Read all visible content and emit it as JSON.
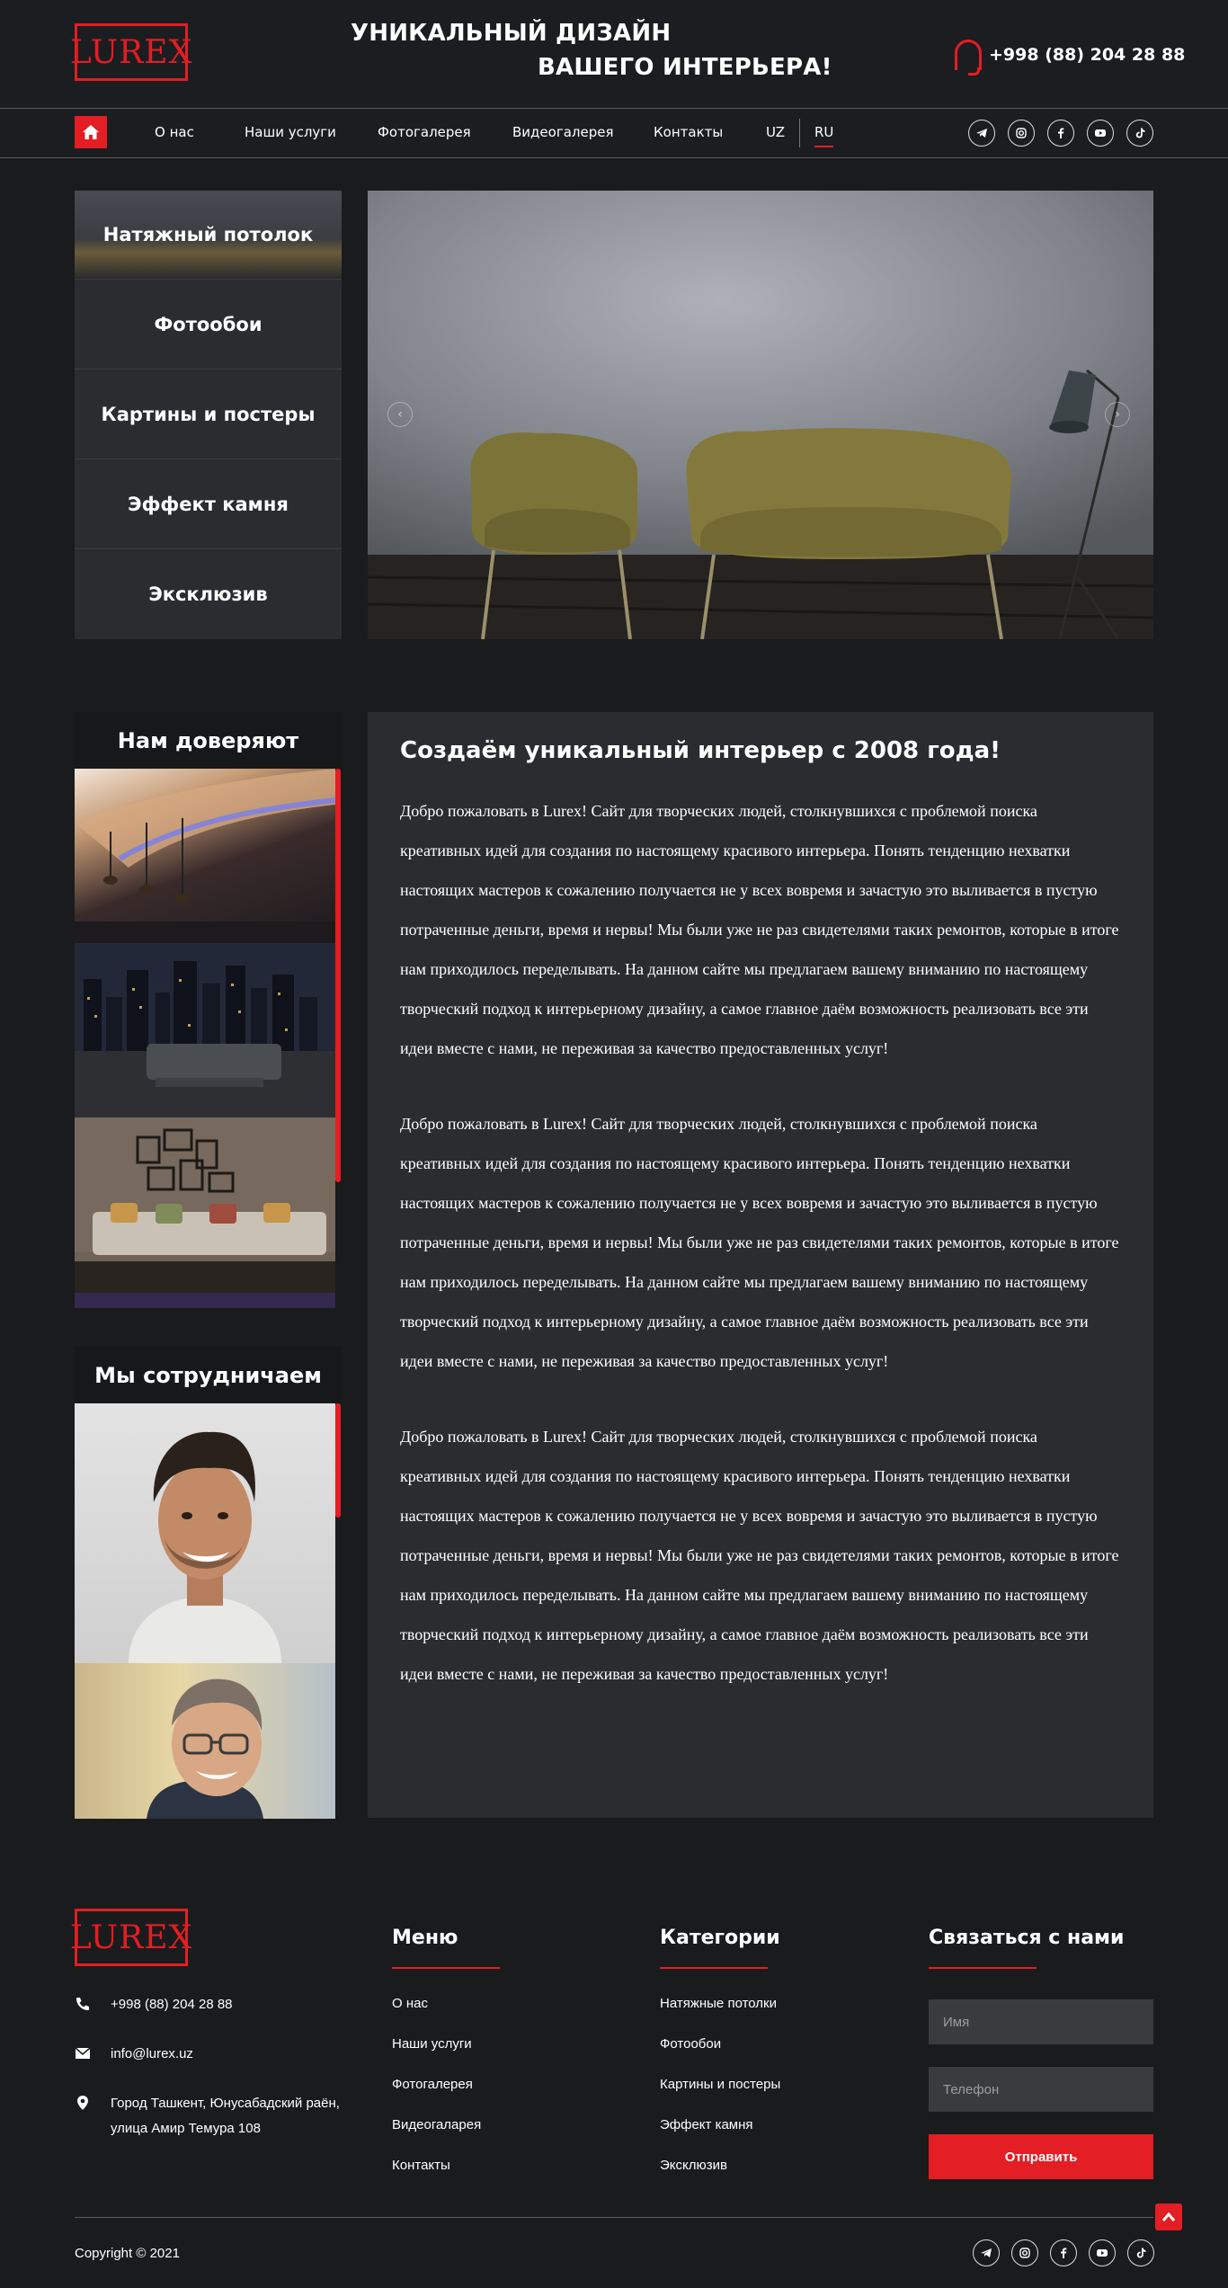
{
  "header": {
    "logo_text": "LUREX",
    "slogan_line1": "УНИКАЛЬНЫЙ ДИЗАЙН",
    "slogan_line2": "ВАШЕГО ИНТЕРЬЕРА!",
    "phone": "+998 (88) 204 28 88"
  },
  "nav": {
    "items": [
      "О нас",
      "Наши услуги",
      "Фотогалерея",
      "Видеогалерея",
      "Контакты"
    ],
    "lang_uz": "UZ",
    "lang_ru": "RU",
    "socials": [
      "telegram-icon",
      "instagram-icon",
      "facebook-icon",
      "youtube-icon",
      "tiktok-icon"
    ]
  },
  "categories": [
    "Натяжный потолок",
    "Фотообои",
    "Картины и постеры",
    "Эффект камня",
    "Эксклюзив"
  ],
  "sidebar": {
    "trust_title": "Нам доверяют",
    "partners_title": "Мы сотрудничаем"
  },
  "content": {
    "title": "Создаём уникальный интерьер с 2008 года!",
    "paragraphs": [
      "Добро пожаловать в Lurex! Сайт для творческих людей, столкнувшихся с проблемой поиска креативных идей для создания по настоящему красивого интерьера. Понять тенденцию нехватки настоящих мастеров к сожалению получается не у всех вовремя и зачастую это выливается в пустую потраченные деньги, время и нервы! Мы были уже не раз свидетелями таких ремонтов, которые в итоге нам приходилось переделывать. На данном сайте мы предлагаем вашему вниманию по настоящему творческий подход к интерьерному дизайну, а самое главное даём возможность реализовать все эти идеи вместе с нами, не переживая за качество предоставленных услуг!",
      "Добро пожаловать в Lurex! Сайт для творческих людей, столкнувшихся с проблемой поиска креативных идей для создания по настоящему красивого интерьера. Понять тенденцию нехватки настоящих мастеров к сожалению получается не у всех вовремя и зачастую это выливается в пустую потраченные деньги, время и нервы! Мы были уже не раз свидетелями таких ремонтов, которые в итоге нам приходилось переделывать. На данном сайте мы предлагаем вашему вниманию по настоящему творческий подход к интерьерному дизайну, а самое главное даём возможность реализовать все эти идеи вместе с нами, не переживая за качество предоставленных услуг!",
      "Добро пожаловать в Lurex! Сайт для творческих людей, столкнувшихся с проблемой поиска креативных идей для создания по настоящему красивого интерьера. Понять тенденцию нехватки настоящих мастеров к сожалению получается не у всех вовремя и зачастую это выливается в пустую потраченные деньги, время и нервы! Мы были уже не раз свидетелями таких ремонтов, которые в итоге нам приходилось переделывать. На данном сайте мы предлагаем вашему вниманию по настоящему творческий подход к интерьерному дизайну, а самое главное даём возможность реализовать все эти идеи вместе с нами, не переживая за качество предоставленных услуг!"
    ]
  },
  "footer": {
    "phone": "+998 (88) 204 28 88",
    "email": "info@lurex.uz",
    "address_line1": "Город Ташкент, Юнусабадский раён,",
    "address_line2": "улица Амир Темура 108",
    "menu_title": "Меню",
    "menu_items": [
      "О нас",
      "Наши услуги",
      "Фотогалерея",
      "Видеогаларея",
      "Контакты"
    ],
    "cats_title": "Категории",
    "cats_items": [
      "Натяжные потолки",
      "Фотообои",
      "Картины и постеры",
      "Эффект камня",
      "Эксклюзив"
    ],
    "contact_title": "Связаться с нами",
    "name_placeholder": "Имя",
    "phone_placeholder": "Телефон",
    "send_label": "Отправить",
    "copyright": "Copyright © 2021"
  },
  "colors": {
    "accent": "#e31e24",
    "background": "#1a1b1d",
    "panel": "#2b2c30"
  }
}
